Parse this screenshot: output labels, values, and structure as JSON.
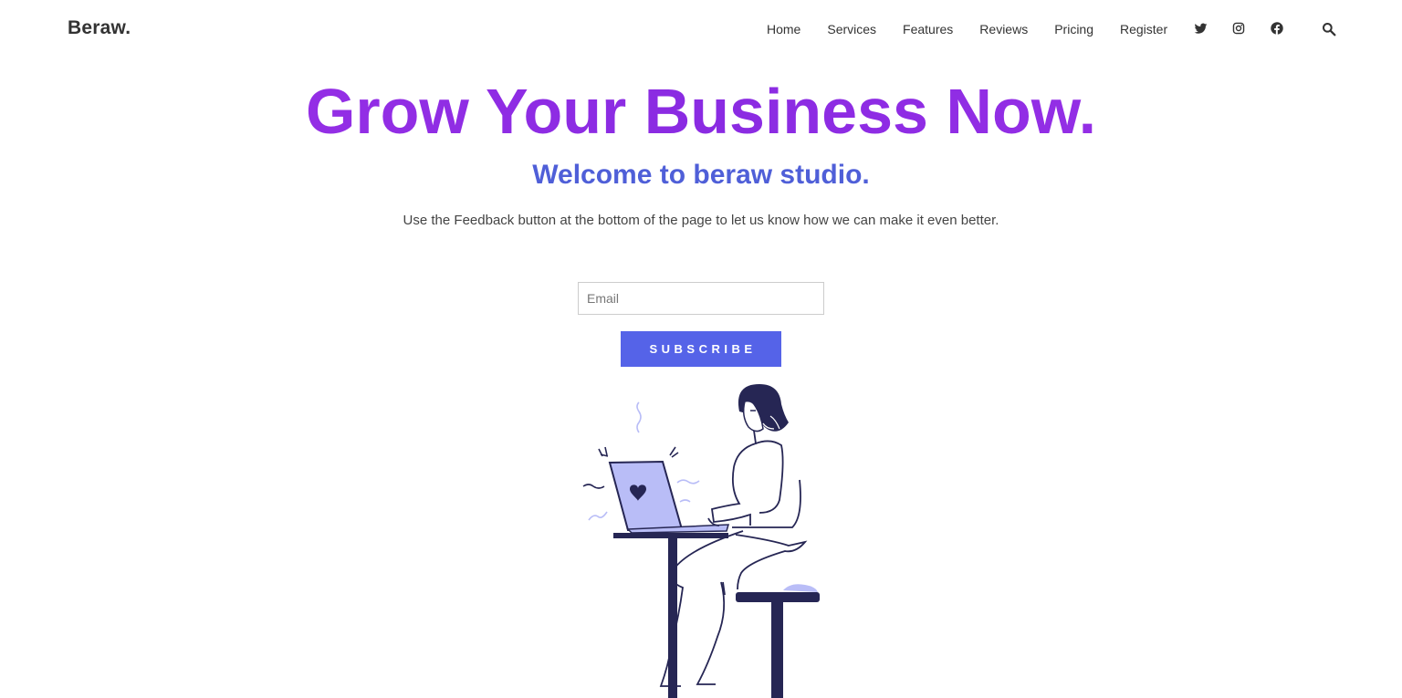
{
  "nav": {
    "brand": "Beraw.",
    "links": [
      "Home",
      "Services",
      "Features",
      "Reviews",
      "Pricing",
      "Register"
    ],
    "social_icons": [
      "twitter-icon",
      "instagram-icon",
      "facebook-icon"
    ],
    "search_icon": "search-icon"
  },
  "hero": {
    "title": "Grow Your Business Now.",
    "subtitle": "Welcome to beraw studio.",
    "text": "Use the Feedback button at the bottom of the page to let us know how we can make it even better."
  },
  "subscribe": {
    "email_placeholder": "Email",
    "email_value": "",
    "button_label": "SUBSCRIBE"
  },
  "colors": {
    "title": "#8a2be2",
    "subtitle": "#4f5fd8",
    "button": "#5563e8",
    "illustration_dark": "#262654",
    "illustration_accent": "#b9bdf7"
  }
}
